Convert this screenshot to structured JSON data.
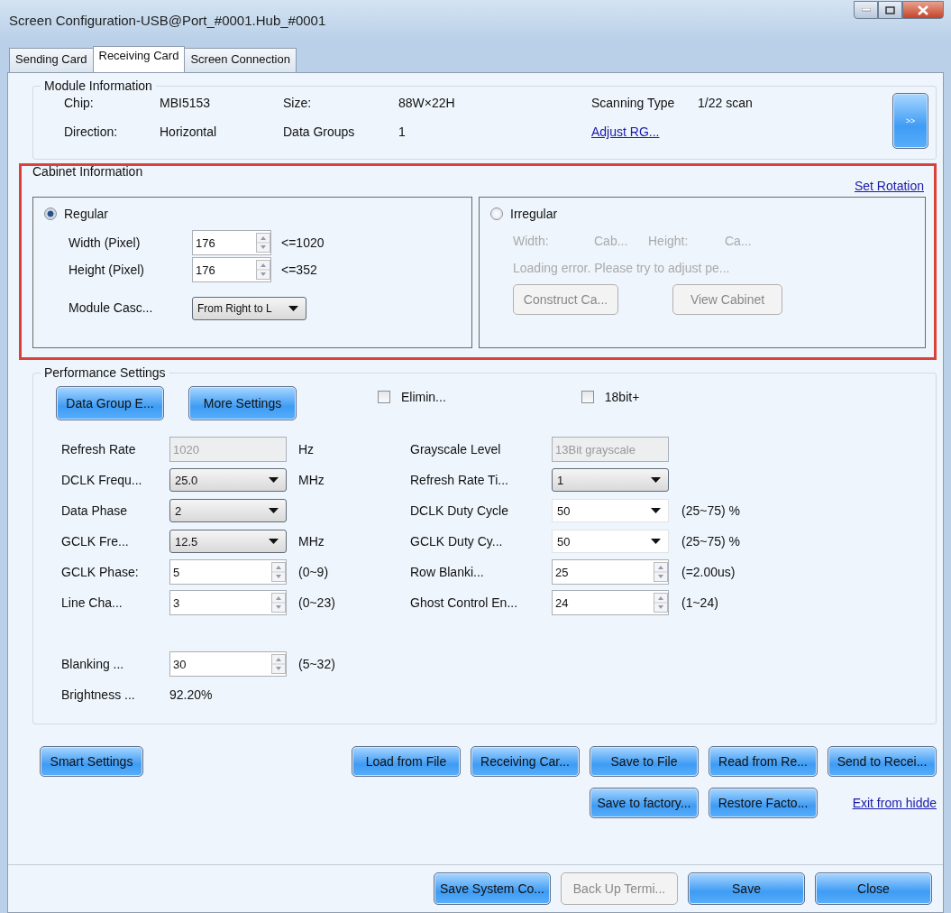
{
  "window": {
    "title": "Screen Configuration-USB@Port_#0001.Hub_#0001"
  },
  "tabs": [
    {
      "label": "Sending Card",
      "selected": false
    },
    {
      "label": "Receiving Card",
      "selected": true
    },
    {
      "label": "Screen Connection",
      "selected": false
    }
  ],
  "module_info": {
    "title": "Module Information",
    "items": [
      {
        "label": "Chip:",
        "value": "MBI5153"
      },
      {
        "label": "Size:",
        "value": "88W×22H"
      },
      {
        "label": "Scanning Type",
        "value": "1/22 scan"
      },
      {
        "label": "Direction:",
        "value": "Horizontal"
      },
      {
        "label": "Data Groups",
        "value": "1"
      }
    ],
    "link": "Adjust RG...",
    "expand_button": ">>"
  },
  "cabinet_info": {
    "title": "Cabinet Information",
    "link": "Set Rotation",
    "regular": {
      "label": "Regular",
      "selected": true,
      "fields": [
        {
          "label": "Width (Pixel)",
          "value": "176",
          "limit": "<=1020"
        },
        {
          "label": "Height (Pixel)",
          "value": "176",
          "limit": "<=352"
        }
      ],
      "cascade": {
        "label": "Module Casc...",
        "value": "From Right to L"
      }
    },
    "irregular": {
      "label": "Irregular",
      "selected": false,
      "texts": [
        "Width:",
        "Cab...",
        "Height:",
        "Ca..."
      ],
      "message": "Loading error. Please try to adjust pe...",
      "buttons": [
        {
          "label": "Construct Ca...",
          "disabled": true
        },
        {
          "label": "View Cabinet",
          "disabled": true
        }
      ]
    }
  },
  "performance": {
    "title": "Performance Settings",
    "buttons": [
      "Data Group E...",
      "More Settings"
    ],
    "checkboxes": [
      {
        "label": "Elimin...",
        "checked": false
      },
      {
        "label": "18bit+",
        "checked": false
      }
    ],
    "left_rows": [
      {
        "label": "Refresh Rate",
        "kind": "text",
        "value": "1020",
        "disabled": true,
        "unit": "Hz"
      },
      {
        "label": "DCLK Frequ...",
        "kind": "dropdown",
        "value": "25.0",
        "unit": "MHz"
      },
      {
        "label": "Data Phase",
        "kind": "dropdown",
        "value": "2"
      },
      {
        "label": "GCLK Fre...",
        "kind": "dropdown",
        "value": "12.5",
        "unit": "MHz"
      },
      {
        "label": "GCLK Phase:",
        "kind": "spin",
        "value": "5",
        "unit": "(0~9)"
      },
      {
        "label": "Line Cha...",
        "kind": "spin",
        "value": "3",
        "unit": "(0~23)"
      }
    ],
    "right_rows": [
      {
        "label": "Grayscale Level",
        "kind": "text",
        "value": "13Bit grayscale",
        "disabled": true
      },
      {
        "label": "Refresh Rate Ti...",
        "kind": "dropdown",
        "value": "1"
      },
      {
        "label": "DCLK Duty Cycle",
        "kind": "flatdropdown",
        "value": "50",
        "unit": "(25~75) %"
      },
      {
        "label": "GCLK Duty Cy...",
        "kind": "flatdropdown",
        "value": "50",
        "unit": "(25~75) %"
      },
      {
        "label": "Row Blanki...",
        "kind": "spin",
        "value": "25",
        "unit": "(=2.00us)"
      },
      {
        "label": "Ghost Control En...",
        "kind": "spin",
        "value": "24",
        "unit": "(1~24)"
      }
    ],
    "extra_rows": [
      {
        "label": "Blanking ...",
        "kind": "spin",
        "value": "30",
        "unit": "(5~32)"
      },
      {
        "label": "Brightness ...",
        "kind": "plain",
        "value": "92.20%"
      }
    ]
  },
  "actions": {
    "smart_button": "Smart Settings",
    "row_1": [
      "Load from File",
      "Receiving Car...",
      "Save to File",
      "Read from Re...",
      "Send to Recei..."
    ],
    "row_2": [
      "Save to factory...",
      "Restore Facto..."
    ],
    "link": "Exit from hidde"
  },
  "footer": [
    {
      "label": "Save System Co...",
      "disabled": false
    },
    {
      "label": "Back Up Termi...",
      "disabled": true
    },
    {
      "label": "Save",
      "disabled": false
    },
    {
      "label": "Close",
      "disabled": false
    }
  ]
}
